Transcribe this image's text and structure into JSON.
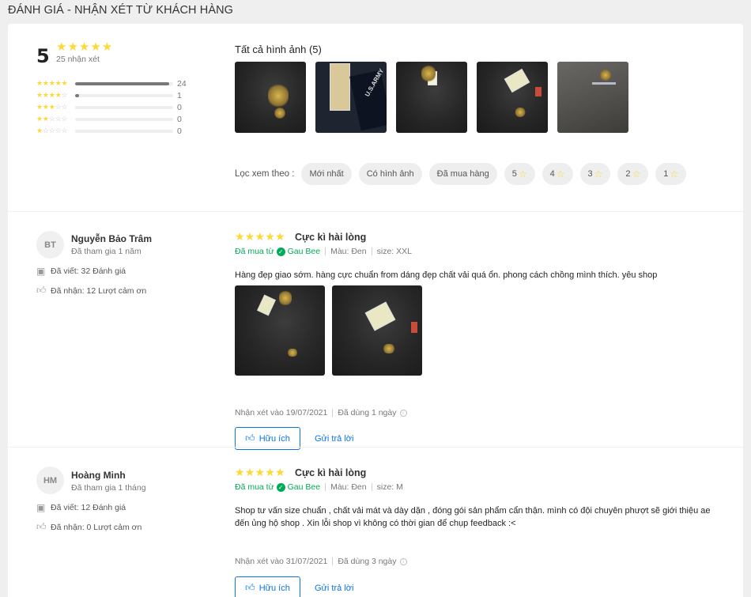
{
  "section_title": "ĐÁNH GIÁ - NHẬN XÉT TỪ KHÁCH HÀNG",
  "summary": {
    "average": "5",
    "count_text": "25 nhận xét",
    "distribution": [
      {
        "stars": 5,
        "count": "24",
        "fraction": 0.96
      },
      {
        "stars": 4,
        "count": "1",
        "fraction": 0.04
      },
      {
        "stars": 3,
        "count": "0",
        "fraction": 0
      },
      {
        "stars": 2,
        "count": "0",
        "fraction": 0
      },
      {
        "stars": 1,
        "count": "0",
        "fraction": 0
      }
    ]
  },
  "photos": {
    "title": "Tất cả hình ảnh (5)",
    "items": [
      "photo-1",
      "photo-2",
      "photo-3",
      "photo-4",
      "photo-5"
    ]
  },
  "filter": {
    "label": "Lọc xem theo :",
    "chips": [
      "Mới nhất",
      "Có hình ảnh",
      "Đã mua hàng"
    ],
    "star_chips": [
      "5",
      "4",
      "3",
      "2",
      "1"
    ]
  },
  "reviews": [
    {
      "initials": "BT",
      "name": "Nguyễn Bảo Trâm",
      "joined": "Đã tham gia 1 năm",
      "written": "Đã viết: 32 Đánh giá",
      "received": "Đã nhận: 12 Lượt cảm ơn",
      "rating": 5,
      "title": "Cực kì hài lòng",
      "bought_prefix": "Đã mua từ",
      "shop": "Gau Bee",
      "color": "Màu: Đen",
      "size": "size: XXL",
      "content": "Hàng đẹp giao sớm. hàng cực chuẩn from dáng đẹp chất vải quá ổn. phong cách chồng mình thích. yêu shop",
      "reviewed_on": "Nhận xét vào 19/07/2021",
      "used_for": "Đã dùng 1 ngày",
      "helpful": "Hữu ích",
      "reply": "Gửi trả lời"
    },
    {
      "initials": "HM",
      "name": "Hoàng Minh",
      "joined": "Đã tham gia 1 tháng",
      "written": "Đã viết: 12 Đánh giá",
      "received": "Đã nhận: 0 Lượt cảm ơn",
      "rating": 5,
      "title": "Cực kì hài lòng",
      "bought_prefix": "Đã mua từ",
      "shop": "Gau Bee",
      "color": "Màu: Đen",
      "size": "size: M",
      "content": "Shop tư vấn size chuẩn , chất vải mát và dày dặn , đóng gói sản phẩm cẩn thận. mình có đội chuyên phượt sẽ giới thiệu ae đến ủng hộ shop . Xin lỗi shop vì không có thời gian để chụp feedback :<",
      "reviewed_on": "Nhận xét vào 31/07/2021",
      "used_for": "Đã dùng 3 ngày",
      "helpful": "Hữu ích",
      "reply": "Gửi trả lời"
    }
  ],
  "colors": {
    "star": "#fdd836",
    "link": "#0b74e5",
    "bought": "#00ab56"
  },
  "icons": [
    "star-icon",
    "check-circle-icon",
    "review-count-icon",
    "thumbs-up-icon",
    "info-icon"
  ]
}
